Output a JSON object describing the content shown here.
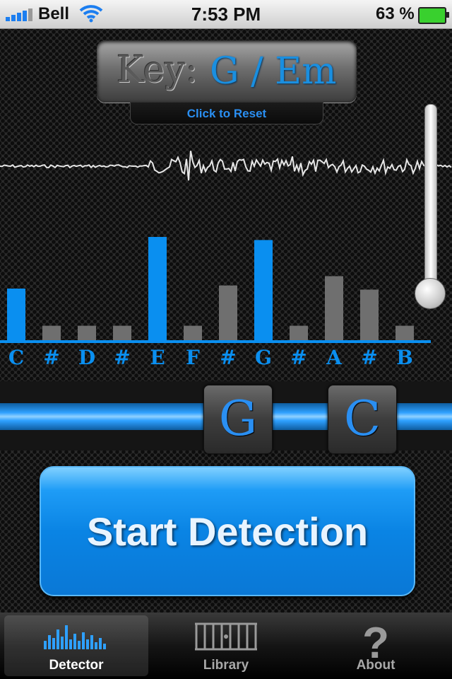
{
  "status_bar": {
    "carrier": "Bell",
    "time": "7:53 PM",
    "battery": "63 %"
  },
  "key_display": {
    "label": "Key:",
    "value": "G / Em",
    "reset": "Click to Reset"
  },
  "chroma": {
    "notes": [
      "C",
      "#",
      "D",
      "#",
      "E",
      "F",
      "#",
      "G",
      "#",
      "A",
      "#",
      "B"
    ],
    "levels": [
      0.5,
      0.14,
      0.14,
      0.14,
      1.0,
      0.14,
      0.53,
      0.97,
      0.14,
      0.62,
      0.49,
      0.14
    ],
    "highlighted": [
      true,
      false,
      false,
      false,
      true,
      false,
      false,
      true,
      false,
      false,
      false,
      false
    ]
  },
  "chords": {
    "current": "G",
    "next": "C"
  },
  "start_button": {
    "label": "Start Detection"
  },
  "tabs": [
    {
      "label": "Detector",
      "icon": "spectrum-icon",
      "active": true
    },
    {
      "label": "Library",
      "icon": "fretboard-icon",
      "active": false
    },
    {
      "label": "About",
      "icon": "question-icon",
      "active": false
    }
  ],
  "colors": {
    "accent": "#0a8ff0",
    "inactive_bar": "#6f6f6f"
  }
}
